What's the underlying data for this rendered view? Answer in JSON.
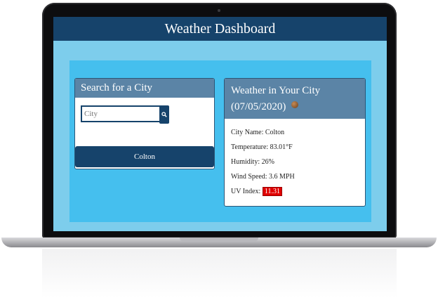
{
  "app": {
    "title": "Weather Dashboard"
  },
  "search": {
    "title": "Search for a City",
    "placeholder": "City",
    "history": [
      "Colton"
    ]
  },
  "weather": {
    "title": "Weather in Your City",
    "date": "(07/05/2020)",
    "city_label": "City Name: Colton",
    "temp_label": "Temperature: 83.01°F",
    "humidity_label": "Humidity: 26%",
    "wind_label": "Wind Speed: 3.6 MPH",
    "uv_label": "UV Index: ",
    "uv_value": "11.31",
    "icon": "weather-condition-icon"
  },
  "colors": {
    "header": "#16436b",
    "card_header": "#5b84a6",
    "panel": "#45bfee",
    "uv_high": "#e00000"
  }
}
